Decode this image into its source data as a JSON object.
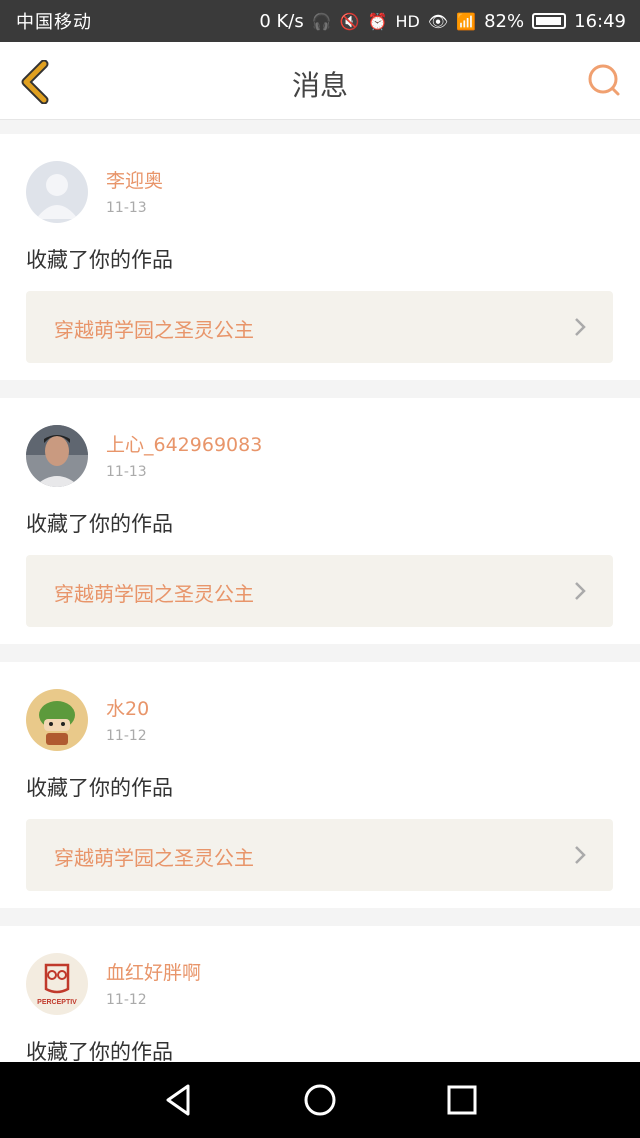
{
  "status_bar": {
    "carrier": "中国移动",
    "speed": "0 K/s",
    "battery": "82%",
    "battery_level": 0.82,
    "time": "16:49"
  },
  "header": {
    "title": "消息"
  },
  "messages": [
    {
      "username": "李迎奥",
      "date": "11-13",
      "action": "收藏了你的作品",
      "work_title": "穿越萌学园之圣灵公主",
      "avatar": "default-avatar"
    },
    {
      "username": "上心_642969083",
      "date": "11-13",
      "action": "收藏了你的作品",
      "work_title": "穿越萌学园之圣灵公主",
      "avatar": "photo-avatar"
    },
    {
      "username": "水20",
      "date": "11-12",
      "action": "收藏了你的作品",
      "work_title": "穿越萌学园之圣灵公主",
      "avatar": "cartoon-avatar"
    },
    {
      "username": "血红好胖啊",
      "date": "11-12",
      "action": "收藏了你的作品",
      "work_title": "",
      "avatar": "owl-logo-avatar",
      "avatar_text": "PERCEPTIV"
    }
  ],
  "colors": {
    "accent": "#e8956a",
    "back_arrow": "#e0a020",
    "status_bar": "#3a3a3a"
  }
}
